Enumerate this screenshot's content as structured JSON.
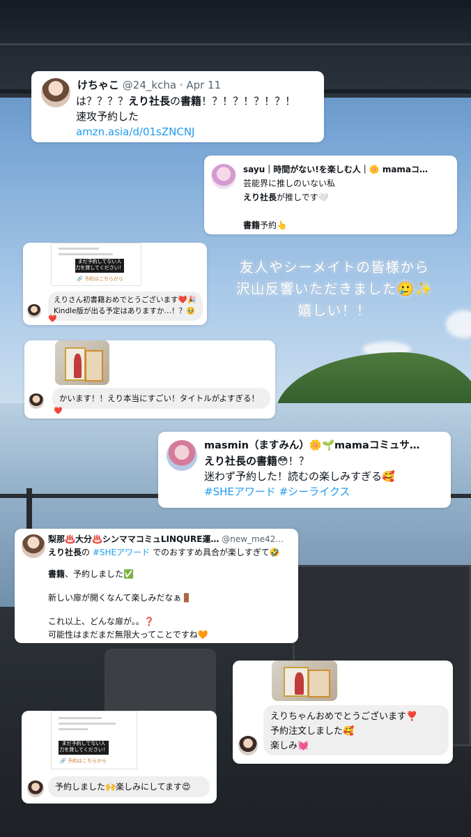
{
  "overlay": {
    "line1": "友人やシーメイトの皆様から",
    "line2": "沢山反響いただきました🥲✨",
    "line3": "嬉しい！！"
  },
  "tweets": [
    {
      "name": "けちゃこ",
      "handle": "@24_kcha · Apr 11",
      "body_parts": [
        {
          "t": "は？？？？",
          "bold": false
        },
        {
          "t": "えり社長",
          "bold": true
        },
        {
          "t": "の",
          "bold": false
        },
        {
          "t": "書籍",
          "bold": true
        },
        {
          "t": "！？！？！？！？！",
          "bold": false
        }
      ],
      "line2": "速攻予約した",
      "link": "amzn.asia/d/01sZNCNJ"
    },
    {
      "name": "sayu｜時間がない!を楽しむ人｜🌼 mamaコ…",
      "line1": "芸能界に推しのいない私",
      "line2_bold": "えり社長",
      "line2_rest": "が推しです🤍",
      "line4_bold": "書籍",
      "line4_rest": "予約👆"
    },
    {
      "name": "masmin（ますみん）🌼🌱mamaコミュサ…",
      "line1_bold": "えり社長の書籍",
      "line1_rest": "😳！？",
      "line2": "迷わず予約した！読むの楽しみすぎる🥰",
      "hashtags": "#SHEアワード #シーライクス"
    },
    {
      "name": "梨那♨️大分♨️シンママコミュLINQURE運…",
      "handle": "@new_me42…",
      "line1_bold": "えり社長",
      "line1_mid": "の ",
      "line1_tag": "#SHEアワード",
      "line1_rest": " でのおすすめ具合が楽しすぎて🤣",
      "line2_bold": "書籍",
      "line2_rest": "、予約しました✅",
      "line3": "新しい扉が開くなんて楽しみだなぁ🚪",
      "line4": "これ以上、どんな扉が。。❓",
      "line5": "可能性はまだまだ無限大ってことですね🧡"
    }
  ],
  "story_replies": [
    {
      "message": "えりさん初書籍おめでとうございます❤️🎉\nKindle版が出る予定はありますか…！？🥹",
      "reaction": "❤️",
      "doc_label": "まだ予約してない人\n力を貸してください！",
      "doc_link": "🔗 予約はこちらから"
    },
    {
      "message": "かいます！！えり本当にすごい！タイトルがよすぎる！",
      "reaction": "❤️"
    },
    {
      "message": "えりちゃんおめでとうございます❣️\n予約注文しました🥰\n楽しみ💓"
    },
    {
      "message": "予約しました🙌楽しみにしてます😍",
      "doc_label": "まだ予約してない人\n力を貸してください！",
      "doc_link": "🔗 予約はこちらから"
    }
  ]
}
